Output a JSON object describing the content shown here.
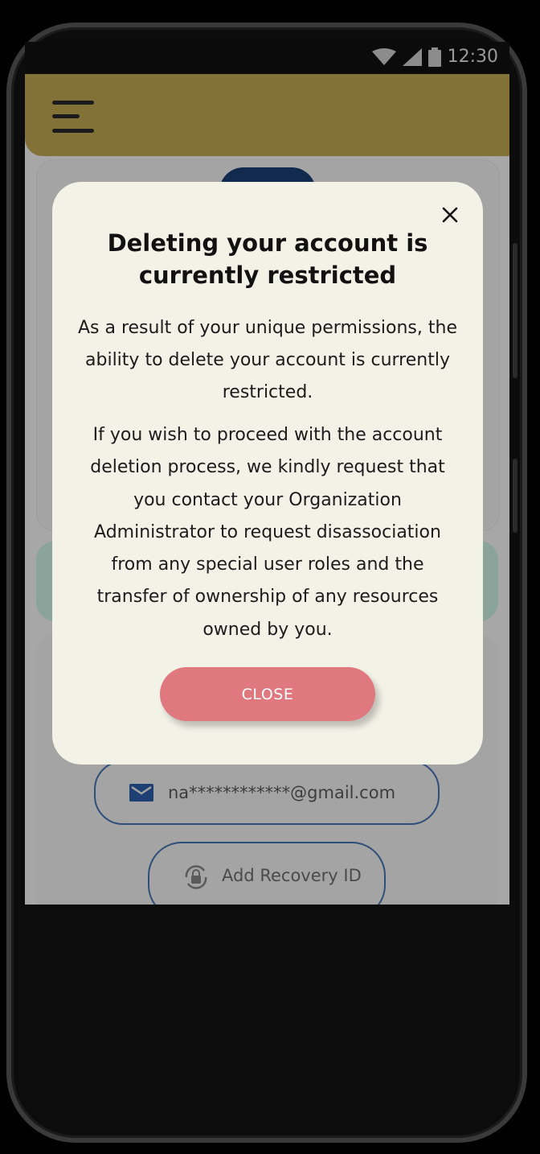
{
  "status_bar": {
    "time": "12:30",
    "icons": [
      "wifi-icon",
      "signal-icon",
      "battery-icon"
    ]
  },
  "app_bar": {
    "menu_icon": "hamburger-menu-icon"
  },
  "background": {
    "email_value": "na************@gmail.com",
    "recovery_button_label": "Add Recovery ID"
  },
  "dialog": {
    "title": "Deleting your account is currently restricted",
    "paragraph_1": "As a result of your unique permissions, the ability to delete your account is currently restricted.",
    "paragraph_2": "If you wish to proceed with the account deletion process, we kindly request that you contact your Organization Administrator to request disassociation from any special user roles and the transfer of ownership of any resources owned by you.",
    "close_button_label": "CLOSE"
  },
  "colors": {
    "app_bar": "#827237",
    "dialog_background": "#f2f2e7",
    "close_button": "#e07880",
    "accent_blue": "#122a4d"
  }
}
